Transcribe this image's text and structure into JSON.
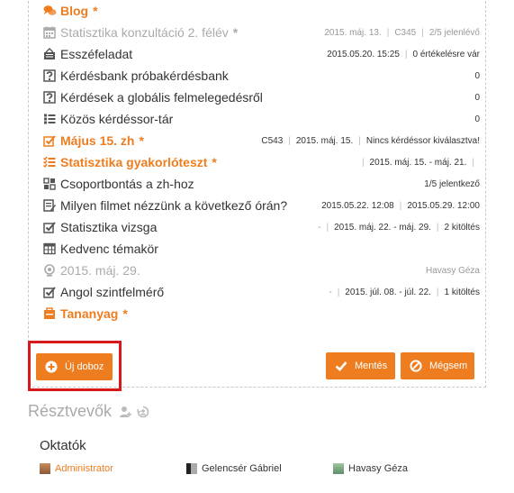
{
  "items": [
    {
      "name": "Blog",
      "star": "*",
      "icon": "comments-icon",
      "group": true
    },
    {
      "name": "Statisztika konzultáció 2. félév",
      "star": "*",
      "icon": "calendar-icon",
      "muted": true,
      "meta": [
        "2015. máj. 13.",
        "C345",
        "2/5 jelenlévő"
      ]
    },
    {
      "name": "Esszéfeladat",
      "icon": "assignment-icon",
      "meta": [
        "2015.05.20. 15:25",
        "0 értékelésre vár"
      ]
    },
    {
      "name": "Kérdésbank próbakérdésbank",
      "icon": "question-bank-icon",
      "meta": [
        "0"
      ]
    },
    {
      "name": "Kérdések a globális felmelegedésről",
      "icon": "question-bank-icon",
      "meta": [
        "0"
      ]
    },
    {
      "name": "Közös kérdéssor-tár",
      "icon": "list-icon",
      "meta": [
        "0"
      ]
    },
    {
      "name": "Május 15. zh",
      "star": "*",
      "icon": "check-edit-icon",
      "group": true,
      "meta": [
        "C543",
        "2015. máj. 15.",
        "Nincs kérdéssor kiválasztva!"
      ]
    },
    {
      "name": "Statisztika gyakorlóteszt",
      "star": "*",
      "icon": "checklist-icon",
      "group": true,
      "meta": [
        "",
        "2015. máj. 15. - máj. 21.",
        ""
      ]
    },
    {
      "name": "Csoportbontás a zh-hoz",
      "icon": "groups-icon",
      "meta": [
        "1/5 jelentkező"
      ]
    },
    {
      "name": "Milyen filmet nézzünk a következő órán?",
      "icon": "poll-icon",
      "meta": [
        "2015.05.22. 12:08",
        "2015.05.29. 12:00"
      ]
    },
    {
      "name": "Statisztika vizsga",
      "icon": "check-edit-icon",
      "meta": [
        "-",
        "2015. máj. 22. - máj. 29.",
        "2 kitöltés"
      ]
    },
    {
      "name": "Kedvenc témakör",
      "icon": "table-icon"
    },
    {
      "name": "2015. máj. 29.",
      "icon": "webcam-icon",
      "muted": true,
      "meta": [
        "Havasy Géza"
      ]
    },
    {
      "name": "Angol szintfelmérő",
      "icon": "check-edit-icon",
      "meta": [
        "-",
        "2015. júl. 08. - júl. 22.",
        "1 kitöltés"
      ]
    },
    {
      "name": "Tananyag",
      "star": "*",
      "icon": "folder-icon",
      "group": true
    }
  ],
  "buttons": {
    "new_box": "Új doboz",
    "save": "Mentés",
    "cancel": "Mégsem"
  },
  "participants": {
    "title": "Résztvevők",
    "teachers_label": "Oktatók",
    "people": [
      {
        "name": "Administrator",
        "link": true
      },
      {
        "name": "Gelencsér Gábriel"
      },
      {
        "name": "Havasy Géza"
      }
    ]
  },
  "colors": {
    "accent": "#ee7d1f",
    "highlight": "#d9181a",
    "muted": "#aaaaaa"
  }
}
